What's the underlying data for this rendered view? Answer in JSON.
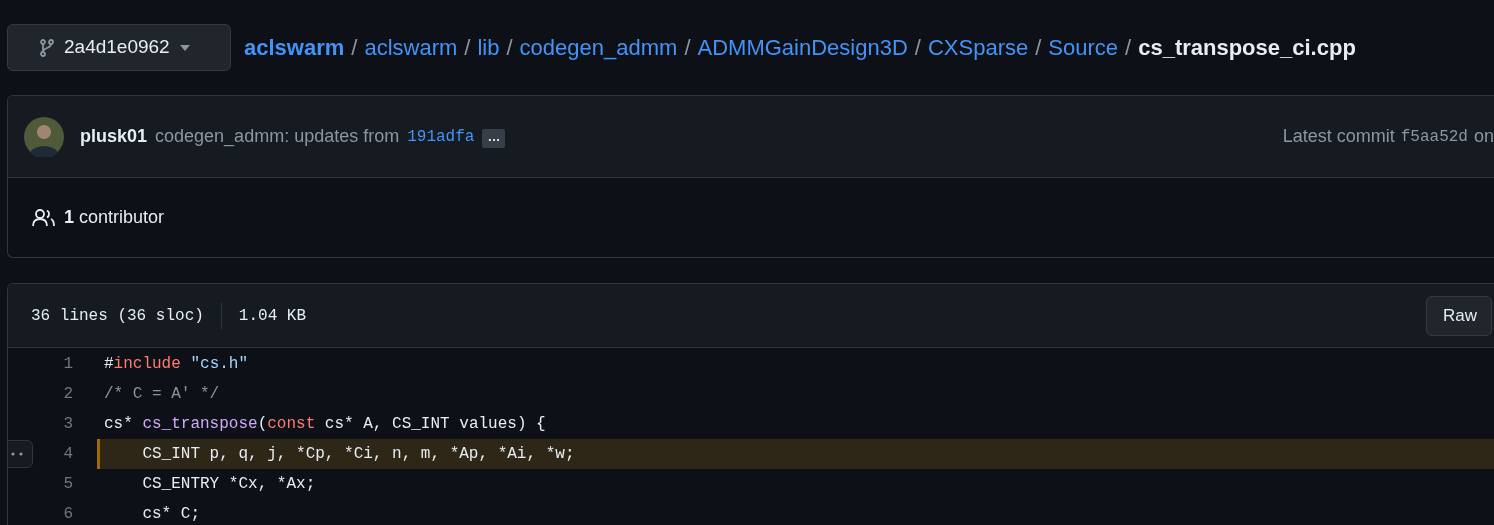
{
  "branch": {
    "label": "2a4d1e0962"
  },
  "breadcrumb": [
    {
      "label": "aclswarm",
      "kind": "owner"
    },
    {
      "label": "aclswarm",
      "kind": "link"
    },
    {
      "label": "lib",
      "kind": "link"
    },
    {
      "label": "codegen_admm",
      "kind": "link"
    },
    {
      "label": "ADMMGainDesign3D",
      "kind": "link"
    },
    {
      "label": "CXSparse",
      "kind": "link"
    },
    {
      "label": "Source",
      "kind": "link"
    },
    {
      "label": "cs_transpose_ci.cpp",
      "kind": "current"
    }
  ],
  "separator": "/",
  "commit": {
    "author": "plusk01",
    "message": "codegen_admm: updates from",
    "sha_link": "191adfa",
    "ellipsis": "…",
    "latest_label": "Latest commit",
    "latest_sha": "f5aa52d",
    "trailing": "on"
  },
  "contributors": {
    "count": "1",
    "label": "contributor"
  },
  "file": {
    "lines_info": "36 lines (36 sloc)",
    "size": "1.04 KB",
    "raw_button": "Raw"
  },
  "code_lines": [
    {
      "number": "1",
      "selected": false,
      "tokens": [
        {
          "kind": "plain",
          "text": "#"
        },
        {
          "kind": "keyword",
          "text": "include"
        },
        {
          "kind": "string",
          "text": " \"cs.h\""
        }
      ]
    },
    {
      "number": "2",
      "selected": false,
      "tokens": [
        {
          "kind": "comment",
          "text": "/* C = A' */"
        }
      ]
    },
    {
      "number": "3",
      "selected": false,
      "tokens": [
        {
          "kind": "plain",
          "text": "cs* "
        },
        {
          "kind": "function",
          "text": "cs_transpose"
        },
        {
          "kind": "plain",
          "text": "("
        },
        {
          "kind": "keyword",
          "text": "const"
        },
        {
          "kind": "plain",
          "text": " cs* A, CS_INT values) {"
        }
      ]
    },
    {
      "number": "4",
      "selected": true,
      "tokens": [
        {
          "kind": "plain",
          "text": "    CS_INT p, q, j, *Cp, *Ci, n, m, *Ap, *Ai, *w;"
        }
      ]
    },
    {
      "number": "5",
      "selected": false,
      "tokens": [
        {
          "kind": "plain",
          "text": "    CS_ENTRY *Cx, *Ax;"
        }
      ]
    },
    {
      "number": "6",
      "selected": false,
      "tokens": [
        {
          "kind": "plain",
          "text": "    cs* C;"
        }
      ]
    }
  ]
}
